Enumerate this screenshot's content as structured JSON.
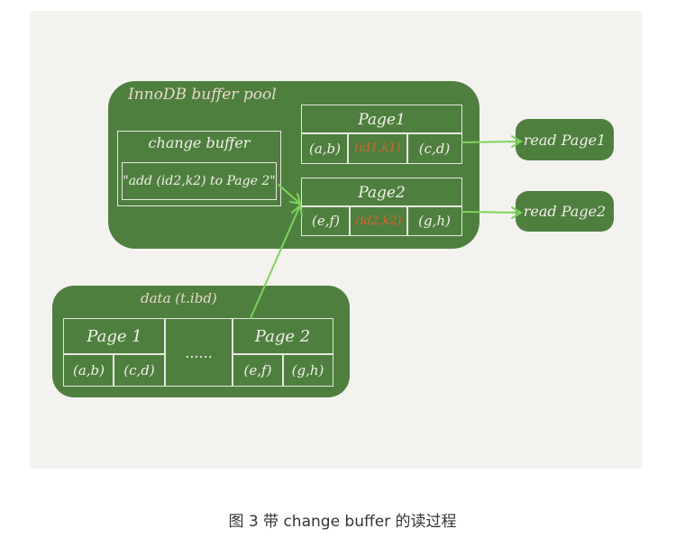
{
  "diagram": {
    "buffer_pool_label": "InnoDB buffer pool",
    "change_buffer": {
      "title": "change buffer",
      "entry": "\"add (id2,k2) to Page 2\""
    },
    "pool_page1": {
      "title": "Page1",
      "cells": [
        "(a,b)",
        "(id1,k1)",
        "(c,d)"
      ]
    },
    "pool_page2": {
      "title": "Page2",
      "cells": [
        "(e,f)",
        "(id2,k2)",
        "(g,h)"
      ]
    },
    "read_page1": "read Page1",
    "read_page2": "read Page2",
    "data": {
      "label": "data (t.ibd)",
      "page1_title": "Page 1",
      "page1_cells": [
        "(a,b)",
        "(c,d)"
      ],
      "ellipsis": "......",
      "page2_title": "Page 2",
      "page2_cells": [
        "(e,f)",
        "(g,h)"
      ]
    }
  },
  "caption": "图 3 带 change buffer 的读过程",
  "colors": {
    "box_green": "#4f7f3f",
    "arrow_green": "#7fd35a",
    "highlight": "#d9642a"
  }
}
